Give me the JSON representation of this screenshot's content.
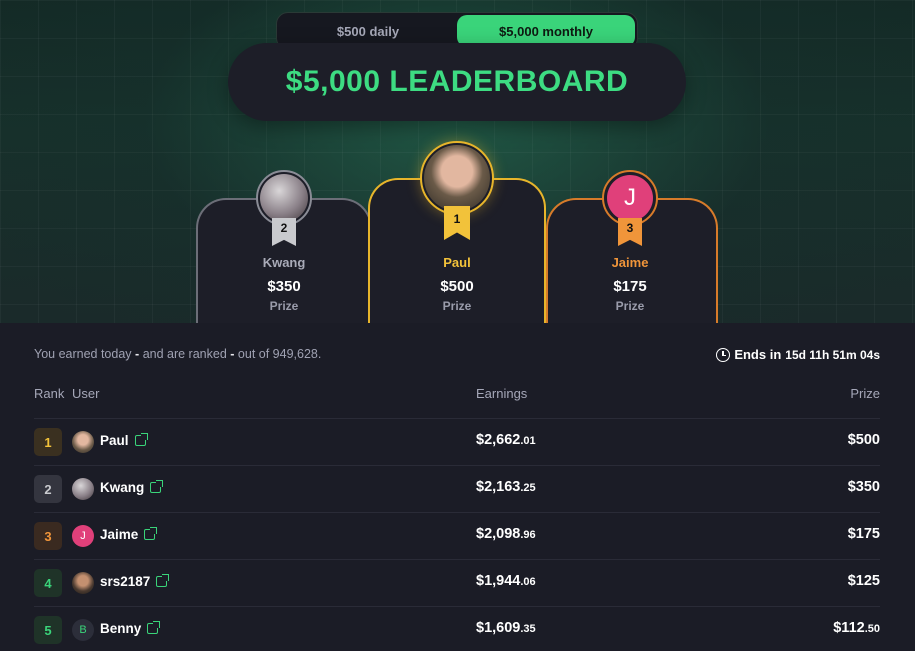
{
  "toggle": {
    "options": [
      "$500 daily",
      "$5,000 monthly"
    ],
    "active": "$5,000 monthly"
  },
  "title": "$5,000 LEADERBOARD",
  "podium": {
    "first": {
      "rank": "1",
      "name": "Paul",
      "prize": "$500",
      "label": "Prize",
      "color": "#f2c23a"
    },
    "second": {
      "rank": "2",
      "name": "Kwang",
      "prize": "$350",
      "label": "Prize",
      "color": "#c9cace"
    },
    "third": {
      "rank": "3",
      "name": "Jaime",
      "prize": "$175",
      "label": "Prize",
      "color": "#f0953a",
      "avatar_letter": "J"
    }
  },
  "info": {
    "part1": "You earned today",
    "dash1": "-",
    "part2": "and are ranked",
    "dash2": "-",
    "part3": "out of 949,628."
  },
  "ends": {
    "label": "Ends in",
    "time": "15d 11h 51m 04s"
  },
  "table": {
    "headers": {
      "rank": "Rank",
      "user": "User",
      "earnings": "Earnings",
      "prize": "Prize"
    },
    "rows": [
      {
        "rank": "1",
        "name": "Paul",
        "earn_main": "$2,662",
        "earn_cents": ".01",
        "prize_main": "$500",
        "prize_cents": "",
        "rank_color": "#f2c23a",
        "rank_bg": "#3a3020"
      },
      {
        "rank": "2",
        "name": "Kwang",
        "earn_main": "$2,163",
        "earn_cents": ".25",
        "prize_main": "$350",
        "prize_cents": "",
        "rank_color": "#c9cace",
        "rank_bg": "#34353f"
      },
      {
        "rank": "3",
        "name": "Jaime",
        "earn_main": "$2,098",
        "earn_cents": ".96",
        "prize_main": "$175",
        "prize_cents": "",
        "rank_color": "#f0953a",
        "rank_bg": "#3a2a20",
        "avatar_letter": "J"
      },
      {
        "rank": "4",
        "name": "srs2187",
        "earn_main": "$1,944",
        "earn_cents": ".06",
        "prize_main": "$125",
        "prize_cents": "",
        "rank_color": "#3ad47a",
        "rank_bg": "#1f3328"
      },
      {
        "rank": "5",
        "name": "Benny",
        "earn_main": "$1,609",
        "earn_cents": ".35",
        "prize_main": "$112",
        "prize_cents": ".50",
        "rank_color": "#3ad47a",
        "rank_bg": "#1f3328",
        "avatar_letter": "B"
      }
    ]
  }
}
